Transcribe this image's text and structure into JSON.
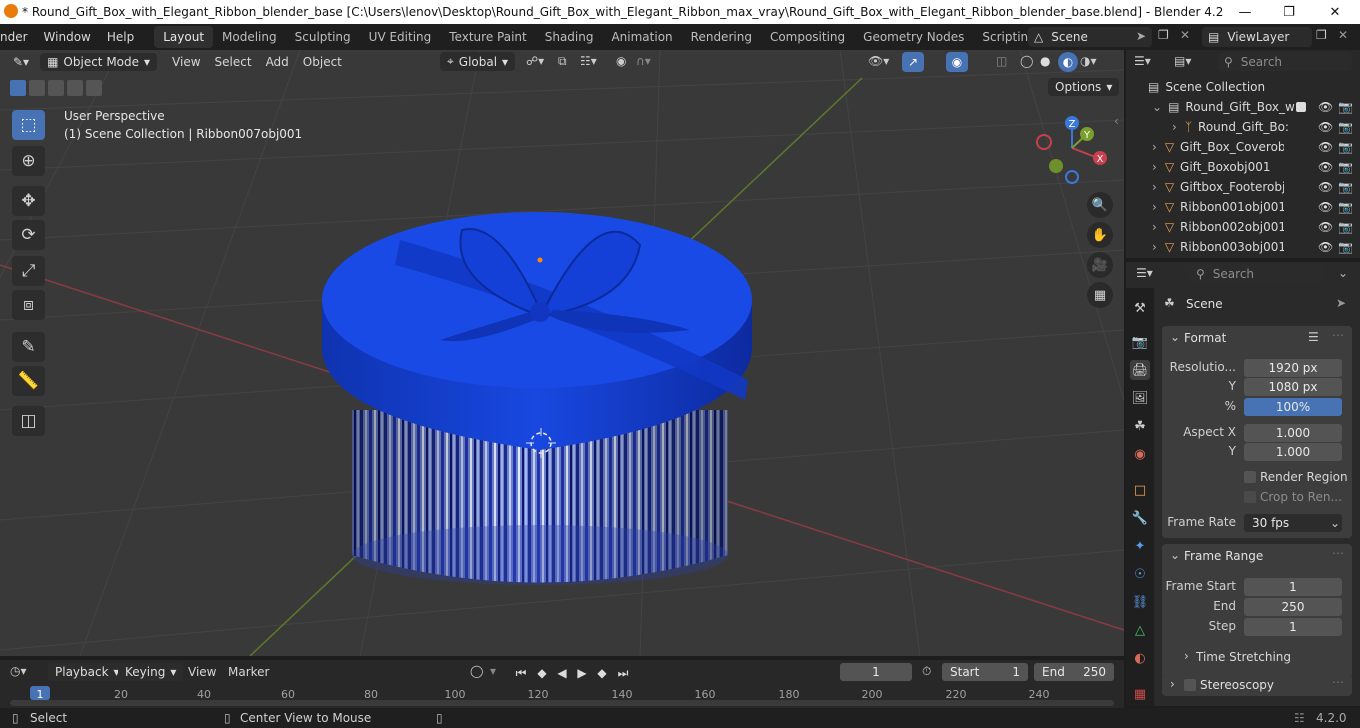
{
  "window": {
    "title": "* Round_Gift_Box_with_Elegant_Ribbon_blender_base [C:\\Users\\lenov\\Desktop\\Round_Gift_Box_with_Elegant_Ribbon_max_vray\\Round_Gift_Box_with_Elegant_Ribbon_blender_base.blend] - Blender 4.2"
  },
  "menu": [
    "nder",
    "Window",
    "Help"
  ],
  "workspaces": [
    "Layout",
    "Modeling",
    "Sculpting",
    "UV Editing",
    "Texture Paint",
    "Shading",
    "Animation",
    "Rendering",
    "Compositing",
    "Geometry Nodes",
    "Scripting"
  ],
  "active_workspace": "Layout",
  "scene_field": "Scene",
  "viewlayer_field": "ViewLayer",
  "viewport": {
    "mode": "Object Mode",
    "menus": [
      "View",
      "Select",
      "Add",
      "Object"
    ],
    "orientation": "Global",
    "options_label": "Options",
    "overlay_line1": "User Perspective",
    "overlay_line2": "(1) Scene Collection | Ribbon007obj001",
    "gizmo": {
      "x": "X",
      "y": "Y",
      "z": "Z"
    }
  },
  "outliner": {
    "search_placeholder": "Search",
    "root": "Scene Collection",
    "items": [
      {
        "label": "Round_Gift_Box_wi",
        "type": "collection"
      },
      {
        "label": "Round_Gift_Bo:",
        "type": "armature"
      },
      {
        "label": "Gift_Box_Coverobj(",
        "type": "mesh"
      },
      {
        "label": "Gift_Boxobj001",
        "type": "mesh"
      },
      {
        "label": "Giftbox_Footerobj(",
        "type": "mesh"
      },
      {
        "label": "Ribbon001obj001",
        "type": "mesh"
      },
      {
        "label": "Ribbon002obj001",
        "type": "mesh"
      },
      {
        "label": "Ribbon003obj001",
        "type": "mesh"
      }
    ]
  },
  "properties": {
    "search_placeholder": "Search",
    "context": "Scene",
    "format": {
      "title": "Format",
      "resolution_x_label": "Resolutio...",
      "resolution_x": "1920 px",
      "resolution_y_label": "Y",
      "resolution_y": "1080 px",
      "percent_label": "%",
      "percent": "100%",
      "aspect_x_label": "Aspect X",
      "aspect_x": "1.000",
      "aspect_y_label": "Y",
      "aspect_y": "1.000",
      "render_region": "Render Region",
      "crop": "Crop to Ren...",
      "frame_rate_label": "Frame Rate",
      "frame_rate": "30 fps"
    },
    "frame_range": {
      "title": "Frame Range",
      "start_label": "Frame Start",
      "start": "1",
      "end_label": "End",
      "end": "250",
      "step_label": "Step",
      "step": "1"
    },
    "time_stretching": "Time Stretching",
    "stereoscopy": "Stereoscopy"
  },
  "timeline": {
    "menus": [
      "Playback",
      "Keying",
      "View",
      "Marker"
    ],
    "current_frame": "1",
    "start_label": "Start",
    "start": "1",
    "end_label": "End",
    "end": "250",
    "ticks": [
      "1",
      "20",
      "40",
      "60",
      "80",
      "100",
      "120",
      "140",
      "160",
      "180",
      "200",
      "220",
      "240"
    ]
  },
  "statusbar": {
    "select": "Select",
    "center": "Center View to Mouse",
    "version": "4.2.0"
  },
  "colors": {
    "accent": "#4772b3",
    "x_axis": "#c8404d",
    "y_axis": "#78a02a",
    "z_axis": "#3a78d8",
    "box_blue": "#1440d0"
  }
}
